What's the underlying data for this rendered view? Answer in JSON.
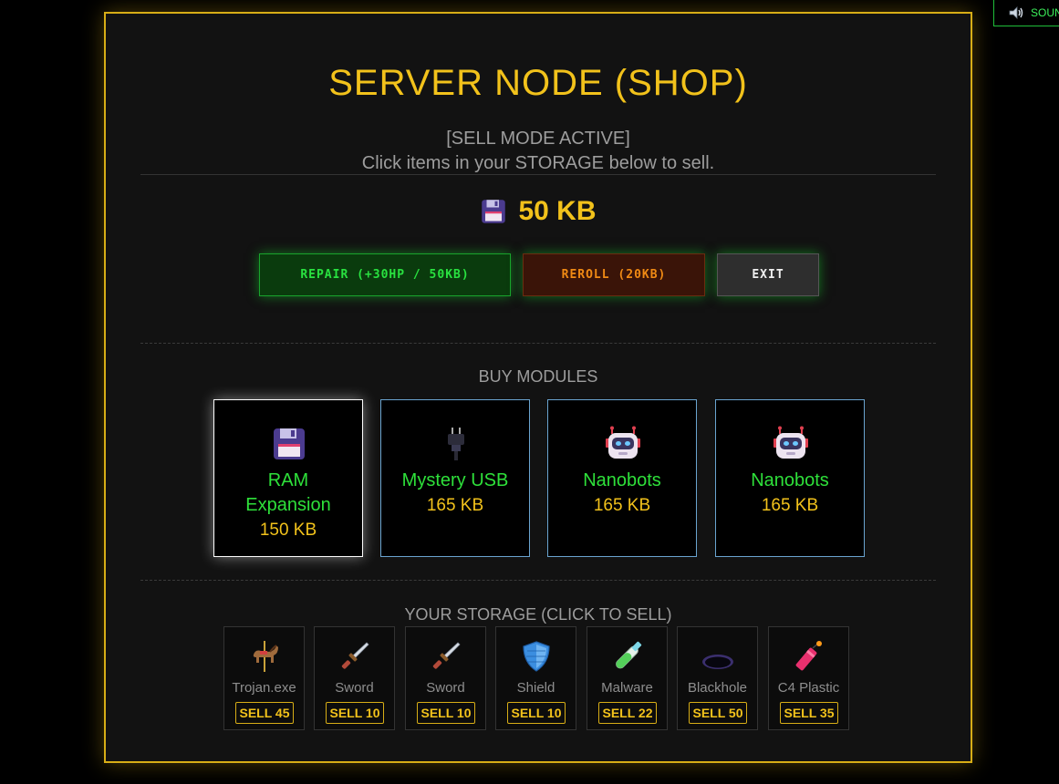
{
  "sound": {
    "label": "SOUN",
    "icon": "speaker-icon"
  },
  "shop": {
    "title": "SERVER NODE (SHOP)",
    "mode": "[SELL MODE ACTIVE]",
    "hint": "Click items in your STORAGE below to sell.",
    "currency": {
      "icon": "floppy-disk-icon",
      "amount": "50 KB"
    },
    "buttons": {
      "repair": "REPAIR (+30HP / 50KB)",
      "reroll": "REROLL (20KB)",
      "exit": "EXIT"
    },
    "buy_heading": "BUY MODULES",
    "modules": [
      {
        "icon": "floppy-disk-icon",
        "name_line1": "RAM",
        "name_line2": "Expansion",
        "price": "150 KB",
        "selected": true
      },
      {
        "icon": "usb-plug-icon",
        "name": "Mystery USB",
        "price": "165 KB"
      },
      {
        "icon": "robot-icon",
        "name": "Nanobots",
        "price": "165 KB"
      },
      {
        "icon": "robot-icon",
        "name": "Nanobots",
        "price": "165 KB"
      }
    ],
    "storage_heading": "YOUR STORAGE (CLICK TO SELL)",
    "storage": [
      {
        "icon": "carousel-horse-icon",
        "name": "Trojan.exe",
        "sell": "SELL 45"
      },
      {
        "icon": "dagger-icon",
        "name": "Sword",
        "sell": "SELL 10"
      },
      {
        "icon": "dagger-icon",
        "name": "Sword",
        "sell": "SELL 10"
      },
      {
        "icon": "shield-icon",
        "name": "Shield",
        "sell": "SELL 10"
      },
      {
        "icon": "test-tube-icon",
        "name": "Malware",
        "sell": "SELL 22"
      },
      {
        "icon": "hole-icon",
        "name": "Blackhole",
        "sell": "SELL 50"
      },
      {
        "icon": "firecracker-icon",
        "name": "C4 Plastic",
        "sell": "SELL 35"
      }
    ]
  },
  "colors": {
    "accent": "#f2c21b",
    "green": "#2ee03a",
    "border": "#d7ad16"
  }
}
